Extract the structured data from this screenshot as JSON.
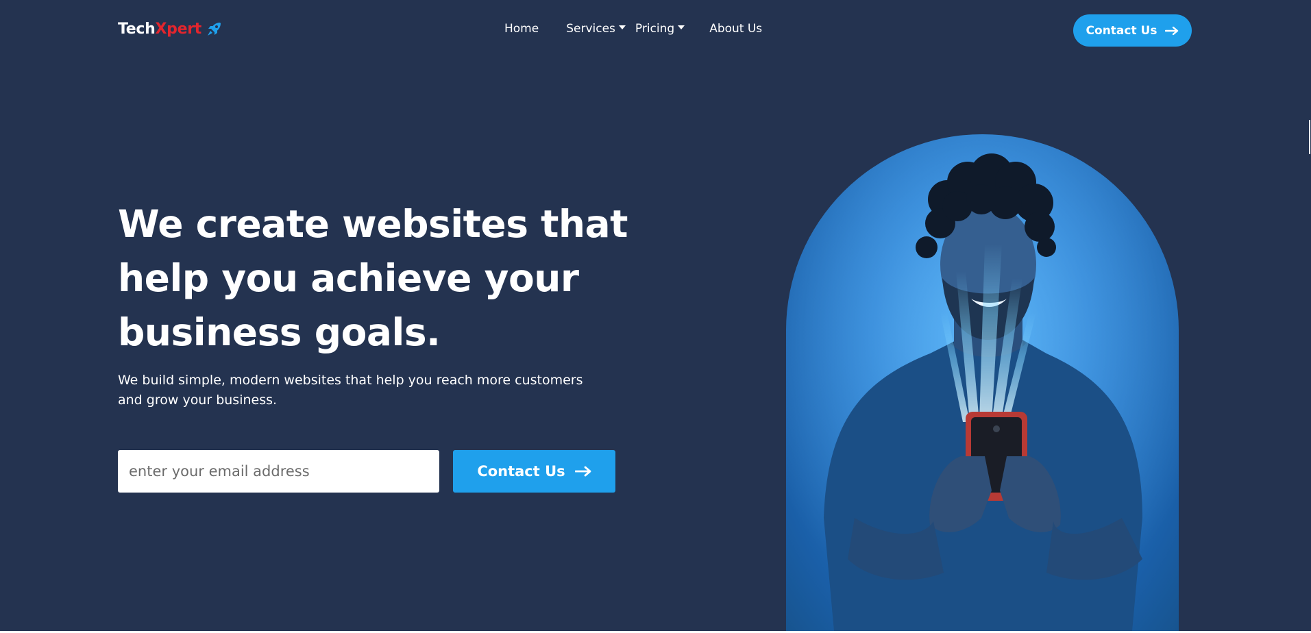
{
  "brand": {
    "name_part1": "Tech",
    "name_part2": "Xpert",
    "icon": "rocket-icon",
    "accent_color": "#e3252d"
  },
  "nav": {
    "items": [
      {
        "label": "Home"
      },
      {
        "label": "Services",
        "icon": "chevron-down-icon"
      },
      {
        "label": "Pricing",
        "icon": "chevron-down-icon"
      },
      {
        "label": "About Us"
      }
    ],
    "cta_label": "Contact Us",
    "cta_icon": "arrow-right-icon"
  },
  "hero": {
    "headline": "We create websites that help you achieve your business goals.",
    "subtext": "We build simple, modern websites that help you reach more customers and grow your business.",
    "email_placeholder": "enter your email address",
    "cta_label": "Contact Us",
    "cta_icon": "arrow-right-icon",
    "image": "man-using-smartphone-illustration"
  },
  "colors": {
    "background": "#243350",
    "primary": "#1fa0ec",
    "text": "#ffffff"
  }
}
